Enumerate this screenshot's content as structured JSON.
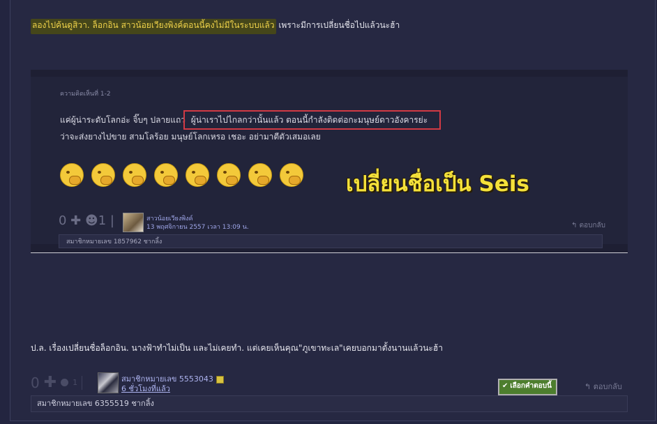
{
  "post": {
    "highlight_text": "ลองไปค้นดูสิวา. ล็อกอิน สาวน้อยเวียงพิงค์ตอนนี้คงไม่มีในระบบแล้ว",
    "rest_text": " เพราะมีการเปลี่ยนชื่อไปแล้วนะฮ้า",
    "note": "ป.ล. เรื่องเปลี่ยนชื่อล็อกอิน. นางฟ้าทำไม่เป็น และไม่เคยทำ.  แต่เคยเห็นคุณ\"ภูเขาทะเล\"เคยบอกมาตั้งนานแล้วนะฮ้า"
  },
  "embedded": {
    "comment_number": "ความคิดเห็นที่ 1-2",
    "line1_a": "แค่ผู้น่าระดับโลกอ่ะ จิ๊บๆ ปลายแถว ",
    "line1_b": "ผู้น่าเราไปไกลกว่านั้นแล้ว  ตอนนี้กำลังติดต่อกะมนุษย์ดาวอังคารย่ะ",
    "line2": "ว่าจะส่งยางไปขาย สามโลร้อย  มนุษย์โลกเหรอ เชอะ อย่ามาตีตัวเสมอเลย",
    "caption": "เปลี่ยนชื่อเป็น Seis",
    "vote": "0 ✚  ☻1 |",
    "username": "สาวน้อยเวียงพิงค์",
    "date": "13 พฤศจิกายน 2557 เวลา 13:09 น.",
    "reply": "↰ ตอบกลับ",
    "footer": "สมาชิกหมายเลข 1857962 ชากลิ้ง"
  },
  "meta": {
    "vote_count": "0",
    "emo_count": "1",
    "member_name": "สมาชิกหมายเลข 5553043",
    "time_ago": "6 ชั่วโมงที่แล้ว",
    "choose_label": "เลือกคำตอบนี้",
    "reply_label": "ตอบกลับ",
    "footer_text": "สมาชิกหมายเลข 6355519 ชากลิ้ง"
  },
  "colors": {
    "highlight_text": "#f0d34a",
    "caption": "#f4e13a",
    "button_green": "#4d7e2e",
    "link": "#aeb4f0"
  }
}
